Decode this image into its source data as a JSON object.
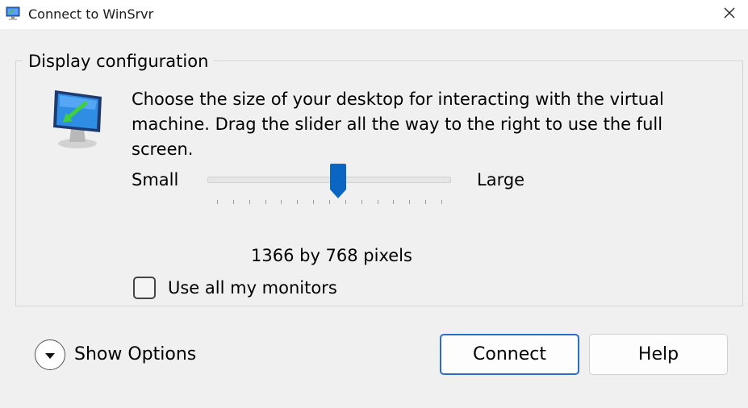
{
  "window": {
    "title": "Connect to WinSrvr"
  },
  "display_config": {
    "group_label": "Display configuration",
    "description": "Choose the size of your desktop for interacting with the virtual machine. Drag the slider all the way to the right to use the full screen.",
    "slider": {
      "min_label": "Small",
      "max_label": "Large",
      "value_fraction": 0.54,
      "tick_count": 15,
      "accent_color": "#0a66c2"
    },
    "resolution_text": "1366 by 768 pixels",
    "use_all_monitors": {
      "label": "Use all my monitors",
      "checked": false
    }
  },
  "footer": {
    "show_options_label": "Show Options",
    "connect_label": "Connect",
    "help_label": "Help"
  },
  "icons": {
    "app": "remote-desktop-icon",
    "close": "close-icon",
    "monitor": "monitor-icon",
    "expand": "chevron-down-icon"
  }
}
